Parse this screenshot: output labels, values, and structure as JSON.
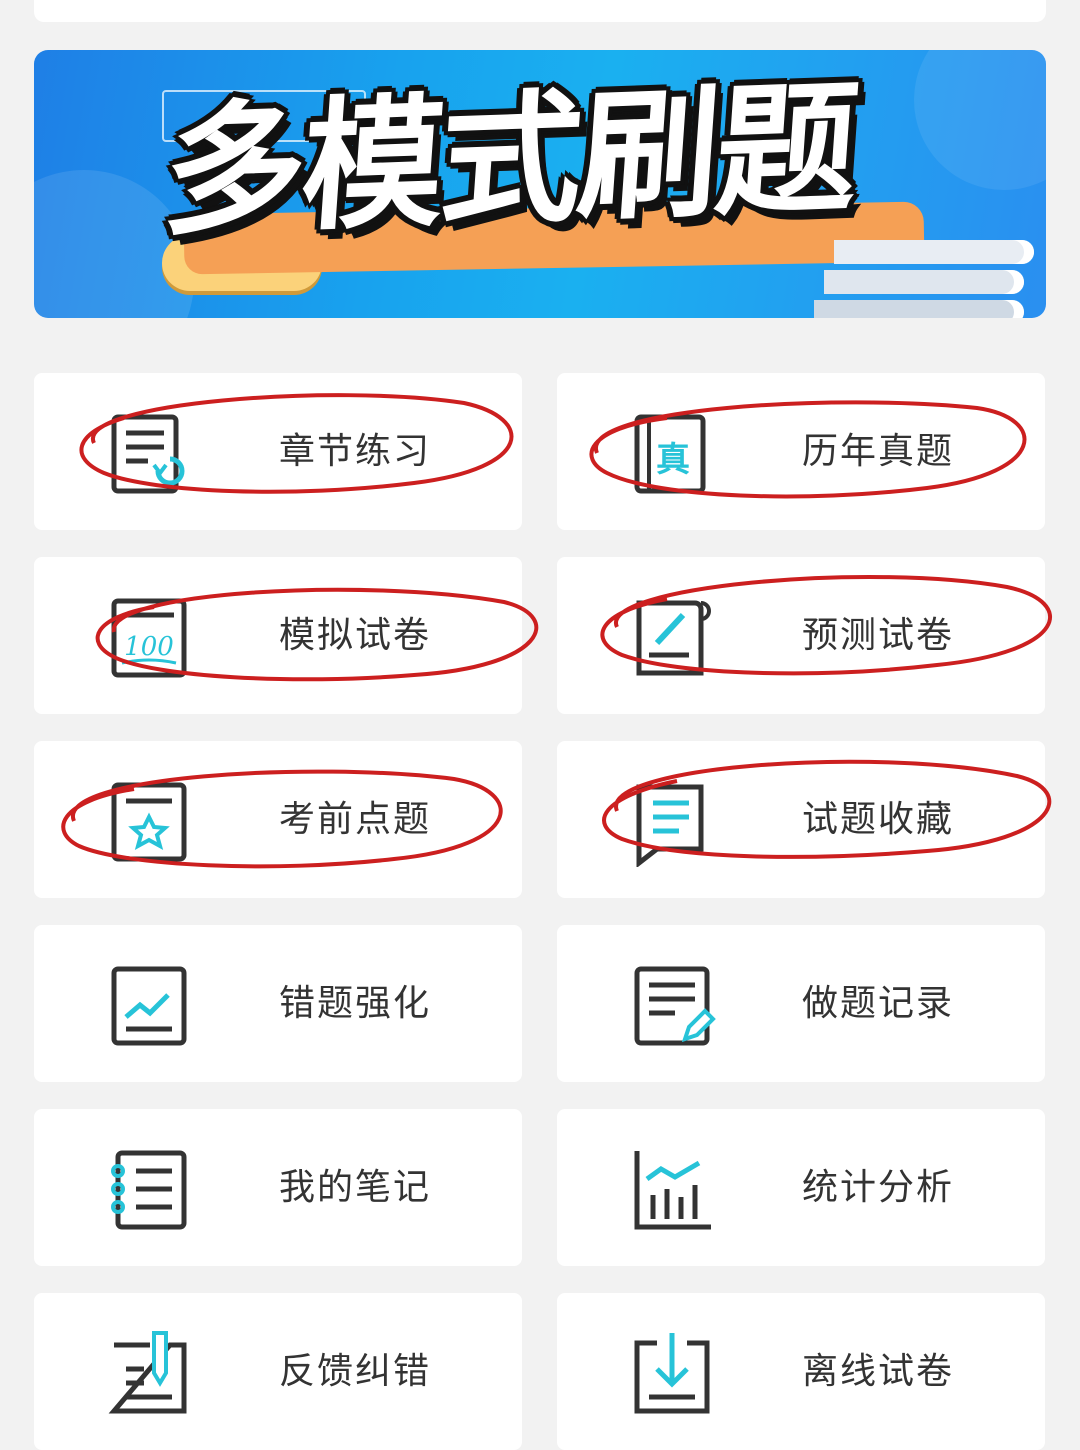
{
  "banner": {
    "title": "多模式刷题"
  },
  "menu": [
    {
      "label": "章节练习",
      "icon": "chapter-practice-icon",
      "circled": true
    },
    {
      "label": "历年真题",
      "icon": "past-exam-icon",
      "circled": true
    },
    {
      "label": "模拟试卷",
      "icon": "mock-exam-icon",
      "circled": true
    },
    {
      "label": "预测试卷",
      "icon": "forecast-exam-icon",
      "circled": true
    },
    {
      "label": "考前点题",
      "icon": "pre-exam-tips-icon",
      "circled": true
    },
    {
      "label": "试题收藏",
      "icon": "favorites-icon",
      "circled": true
    },
    {
      "label": "错题强化",
      "icon": "wrong-questions-icon",
      "circled": false
    },
    {
      "label": "做题记录",
      "icon": "practice-record-icon",
      "circled": false
    },
    {
      "label": "我的笔记",
      "icon": "notes-icon",
      "circled": false
    },
    {
      "label": "统计分析",
      "icon": "statistics-icon",
      "circled": false
    },
    {
      "label": "反馈纠错",
      "icon": "feedback-icon",
      "circled": false
    },
    {
      "label": "离线试卷",
      "icon": "offline-exam-icon",
      "circled": false
    }
  ],
  "colors": {
    "accent": "#27c3d8",
    "icon_stroke": "#333333",
    "annotation_red": "#cc1f1f",
    "tile_bg": "#ffffff",
    "page_bg": "#f2f2f2"
  }
}
